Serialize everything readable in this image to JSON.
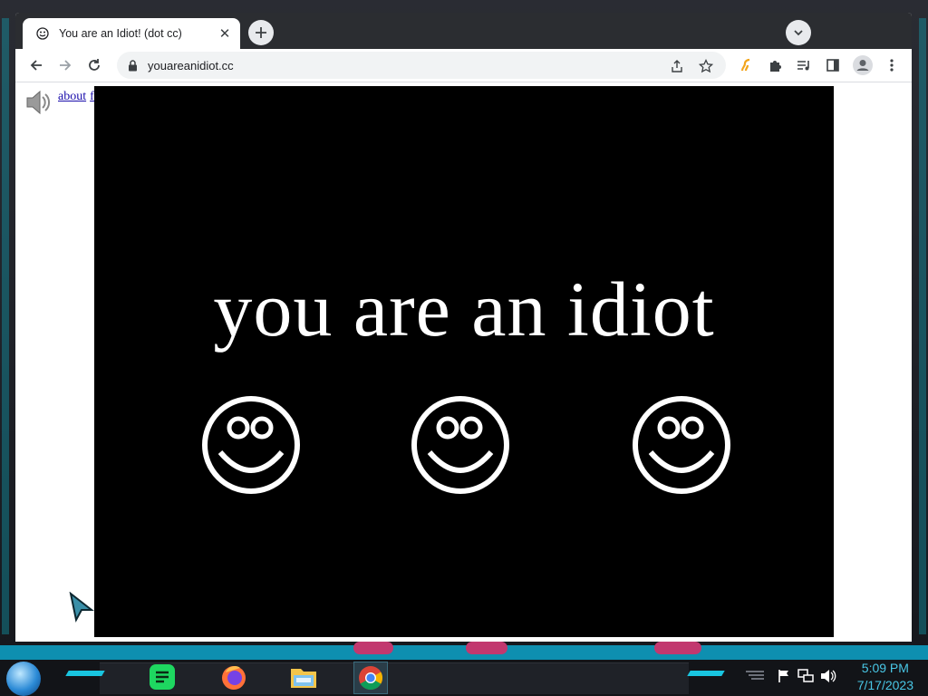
{
  "browser": {
    "tab": {
      "title": "You are an Idiot! (dot cc)",
      "favicon": "smiley-icon"
    },
    "address_bar": {
      "url": "youareanidiot.cc"
    },
    "toolbar_icons": [
      "back-icon",
      "forward-icon",
      "reload-icon",
      "lock-icon",
      "share-icon",
      "star-icon",
      "extension-icon",
      "puzzle-icon",
      "media-icon",
      "sidepanel-icon",
      "profile-icon",
      "menu-icon"
    ]
  },
  "page": {
    "links": {
      "about": "about",
      "flash": "flash"
    },
    "headline": "you are an idiot",
    "smiley_count": 3,
    "background": "#000000",
    "text_color": "#ffffff"
  },
  "taskbar": {
    "apps": [
      "spotify-icon",
      "firefox-icon",
      "file-explorer-icon",
      "chrome-icon"
    ],
    "active_app": "chrome-icon",
    "clock": {
      "time": "5:09 PM",
      "date": "7/17/2023"
    }
  },
  "colors": {
    "accent_cyan": "#19c5e0",
    "clock": "#49c7e6",
    "link": "#1a0dab"
  }
}
